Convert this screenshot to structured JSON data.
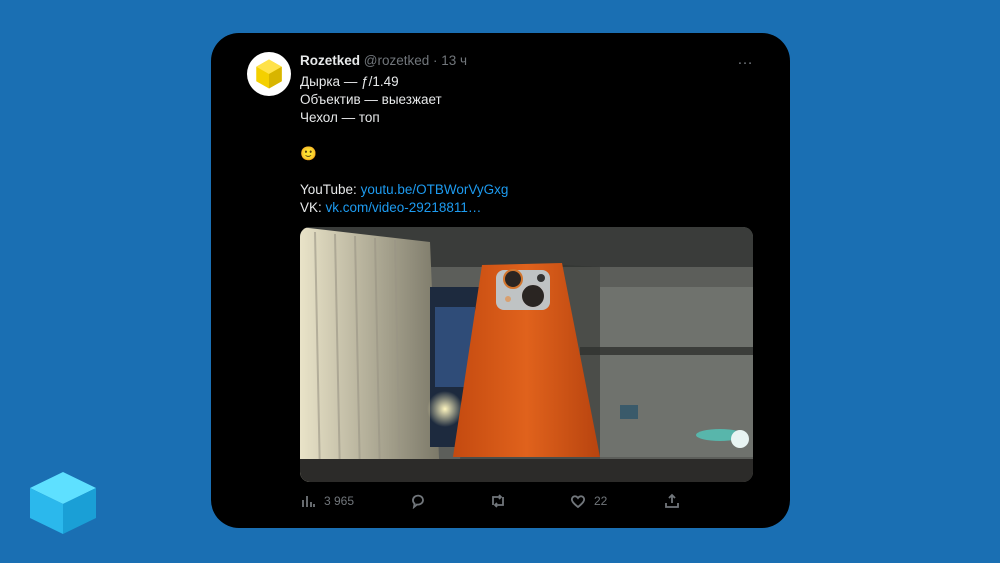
{
  "tweet": {
    "display_name": "Rozetked",
    "handle": "@rozetked",
    "time": "· 13 ч",
    "more_icon": "…",
    "lines": [
      "Дырка — ƒ/1.49",
      "Объектив — выезжает",
      "Чехол — топ",
      "",
      "🙂",
      ""
    ],
    "youtube_label": "YouTube: ",
    "youtube_link": "youtu.be/OTBWorVyGxg",
    "vk_label": "VK: ",
    "vk_link": "vk.com/video-29218811…"
  },
  "actions": {
    "views": "3 965",
    "replies": "",
    "retweets": "",
    "likes": "22",
    "share": ""
  },
  "icons": {
    "views": "bar-chart-icon",
    "reply": "reply-icon",
    "retweet": "retweet-icon",
    "like": "heart-icon",
    "share": "share-icon"
  },
  "colors": {
    "background": "#1a6fb3",
    "card": "#000000",
    "link": "#1d9bf0",
    "muted": "#71767b",
    "avatar_logo": "#f4d000"
  }
}
